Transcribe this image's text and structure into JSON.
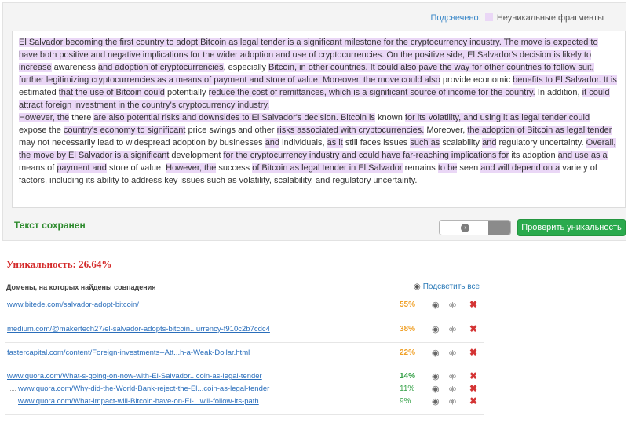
{
  "legend": {
    "label": "Подсвечено:",
    "desc": "Неуникальные фрагменты"
  },
  "colors": {
    "highlight": "#ead7f6",
    "accent_green": "#2aaa4d",
    "uniqueness_red": "#d42a2a"
  },
  "text": {
    "p1": [
      [
        "El Salvador becoming the first country to adopt Bitcoin as legal tender is a significant milestone for the cryptocurrency industry. The move is expected to have both positive and negative implications for the wider adoption and use of cryptocurrencies. On the positive side, El Salvador's decision is likely to increase",
        true
      ],
      [
        " awareness ",
        false
      ],
      [
        "and adoption of cryptocurrencies",
        true
      ],
      [
        ", especially ",
        false
      ],
      [
        "Bitcoin, in other countries. It could also pave the way for other countries to follow suit, further legitimizing cryptocurrencies as a means of payment and store of value. Moreover, the move could also",
        true
      ],
      [
        " provide economic ",
        false
      ],
      [
        "benefits to El Salvador. It is",
        true
      ],
      [
        " estimated ",
        false
      ],
      [
        "that the use of Bitcoin could",
        true
      ],
      [
        " potentially ",
        false
      ],
      [
        "reduce the cost of remittances, which is a significant source of income for the country.",
        true
      ],
      [
        " In addition, ",
        false
      ],
      [
        "it could attract foreign investment in the country's cryptocurrency industry.",
        true
      ]
    ],
    "p2": [
      [
        "However, the",
        true
      ],
      [
        " there ",
        false
      ],
      [
        "are also potential risks and downsides to El Salvador's decision. Bitcoin is",
        true
      ],
      [
        " known ",
        false
      ],
      [
        "for its volatility, and using it as legal tender could",
        true
      ],
      [
        " expose the ",
        false
      ],
      [
        "country's economy to significant",
        true
      ],
      [
        " price swings and other ",
        false
      ],
      [
        "risks associated with cryptocurrencies.",
        true
      ],
      [
        " Moreover, ",
        false
      ],
      [
        "the adoption of Bitcoin as legal tender",
        true
      ],
      [
        " may not necessarily lead to widespread adoption by businesses ",
        false
      ],
      [
        "and",
        true
      ],
      [
        " individuals, ",
        false
      ],
      [
        "as it",
        true
      ],
      [
        " still faces issues ",
        false
      ],
      [
        "such as",
        true
      ],
      [
        " scalability ",
        false
      ],
      [
        "and",
        true
      ],
      [
        " regulatory uncertainty. ",
        false
      ],
      [
        "Overall, the move by El Salvador is a significant",
        true
      ],
      [
        " development ",
        false
      ],
      [
        "for the cryptocurrency industry and could have far-reaching implications for",
        true
      ],
      [
        " its adoption ",
        false
      ],
      [
        "and use as a",
        true
      ],
      [
        " means of ",
        false
      ],
      [
        "payment and",
        true
      ],
      [
        " store of value. ",
        false
      ],
      [
        "However, the",
        true
      ],
      [
        " success ",
        false
      ],
      [
        "of Bitcoin as legal tender in El Salvador",
        true
      ],
      [
        " remains ",
        false
      ],
      [
        "to be",
        true
      ],
      [
        " seen ",
        false
      ],
      [
        "and will depend on a",
        true
      ],
      [
        " variety of factors, including its ability to address key issues such as volatility, scalability, and regulatory uncertainty.",
        false
      ]
    ]
  },
  "status": {
    "saved": "Текст сохранен"
  },
  "check_button": {
    "label": "Проверить уникальность"
  },
  "uniqueness": {
    "label": "Уникальность: 26.64%"
  },
  "domains": {
    "title": "Домены, на которых найдены совпадения",
    "highlight_all": "Подсветить все",
    "rows": [
      {
        "url": "www.bitede.com/salvador-adopt-bitcoin/",
        "pct": "55%",
        "color": "orange"
      },
      {
        "url": "medium.com/@makertech27/el-salvador-adopts-bitcoin...urrency-f910c2b7cdc4",
        "pct": "38%",
        "color": "orange"
      },
      {
        "url": "fastercapital.com/content/Foreign-investments--Att...h-a-Weak-Dollar.html",
        "pct": "22%",
        "color": "orange"
      }
    ],
    "group": {
      "main": {
        "url": "www.quora.com/What-s-going-on-now-with-El-Salvador...coin-as-legal-tender",
        "pct": "14%"
      },
      "children": [
        {
          "url": "www.quora.com/Why-did-the-World-Bank-reject-the-El...coin-as-legal-tender",
          "pct": "11%"
        },
        {
          "url": "www.quora.com/What-impact-will-Bitcoin-have-on-El-...will-follow-its-path",
          "pct": "9%"
        }
      ]
    },
    "icons": {
      "view": "eye-icon",
      "compare": "compare-icon",
      "delete": "delete-icon"
    }
  }
}
